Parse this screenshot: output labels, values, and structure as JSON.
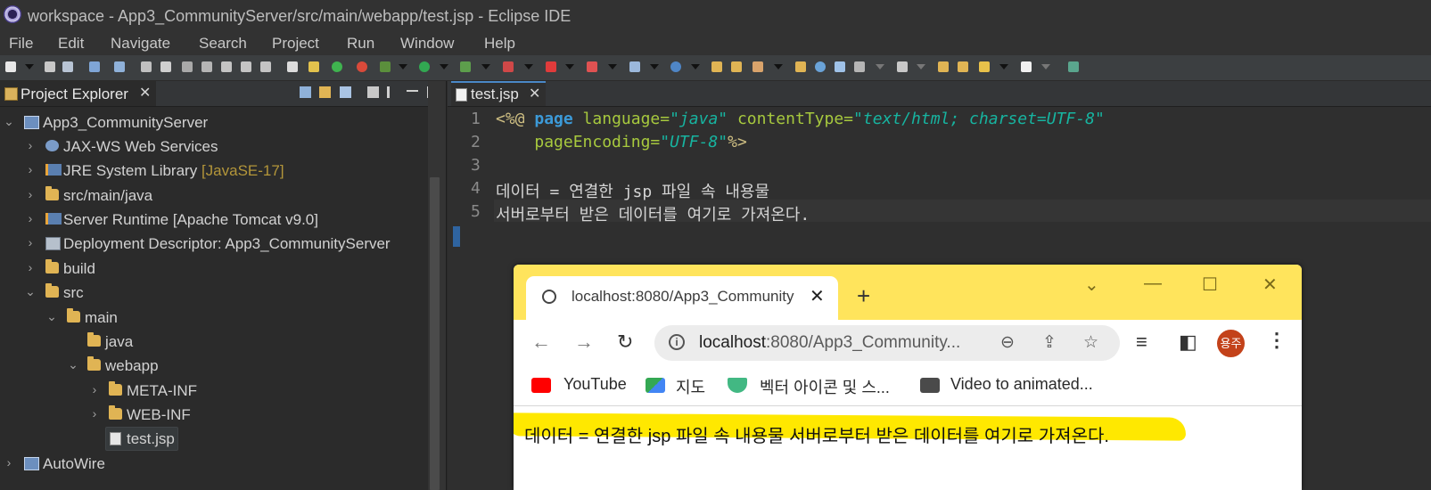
{
  "window": {
    "title": "workspace - App3_CommunityServer/src/main/webapp/test.jsp - Eclipse IDE"
  },
  "menu": [
    "File",
    "Edit",
    "Navigate",
    "Search",
    "Project",
    "Run",
    "Window",
    "Help"
  ],
  "project_explorer": {
    "tab_label": "Project Explorer",
    "tree": [
      {
        "label": "App3_CommunityServer",
        "suffix": "",
        "icon": "project-icon"
      },
      {
        "label": "JAX-WS Web Services",
        "suffix": "",
        "icon": "webservices-icon"
      },
      {
        "label": "JRE System Library ",
        "suffix": "[JavaSE-17]",
        "icon": "library-icon"
      },
      {
        "label": "src/main/java",
        "suffix": "",
        "icon": "folder-icon"
      },
      {
        "label": "Server Runtime [Apache Tomcat v9.0]",
        "suffix": "",
        "icon": "library-icon"
      },
      {
        "label": "Deployment Descriptor: App3_CommunityServer",
        "suffix": "",
        "icon": "descriptor-icon"
      },
      {
        "label": "build",
        "suffix": "",
        "icon": "folder-icon"
      },
      {
        "label": "src",
        "suffix": "",
        "icon": "folder-icon"
      },
      {
        "label": "main",
        "suffix": "",
        "icon": "folder-icon"
      },
      {
        "label": "java",
        "suffix": "",
        "icon": "folder-icon"
      },
      {
        "label": "webapp",
        "suffix": "",
        "icon": "folder-icon"
      },
      {
        "label": "META-INF",
        "suffix": "",
        "icon": "folder-icon"
      },
      {
        "label": "WEB-INF",
        "suffix": "",
        "icon": "folder-icon"
      },
      {
        "label": "test.jsp",
        "suffix": "",
        "icon": "jsp-file-icon"
      },
      {
        "label": "AutoWire",
        "suffix": "",
        "icon": "project-icon"
      }
    ]
  },
  "editor": {
    "tab_label": "test.jsp",
    "line_numbers": [
      "1",
      "2",
      "3",
      "4",
      "5"
    ],
    "lines": {
      "l1": {
        "open": "<%@ ",
        "kw": "page",
        "a1": " language=",
        "v1": "\"java\"",
        "a2": " contentType=",
        "v2": "\"text/html; charset=UTF-8\""
      },
      "l2": {
        "indent": "    ",
        "a1": "pageEncoding=",
        "v1": "\"UTF-8\"",
        "close": "%>"
      },
      "l4": "데이터 = 연결한 jsp 파일 속 내용물",
      "l5": "서버로부터 받은 데이터를 여기로 가져온다."
    }
  },
  "browser": {
    "tab_title": "localhost:8080/App3_Community",
    "url_host": "localhost",
    "url_rest": ":8080/App3_Community...",
    "avatar_text": "용주",
    "bookmarks": [
      "YouTube",
      "지도",
      "벡터 아이콘 및 스...",
      "Video to animated..."
    ],
    "page_text": "데이터 = 연결한 jsp 파일 속 내용물 서버로부터 받은 데이터를 여기로 가져온다.",
    "colors": {
      "tab_strip": "#ffe45c",
      "highlight": "#ffe800",
      "avatar": "#c3421a"
    }
  }
}
